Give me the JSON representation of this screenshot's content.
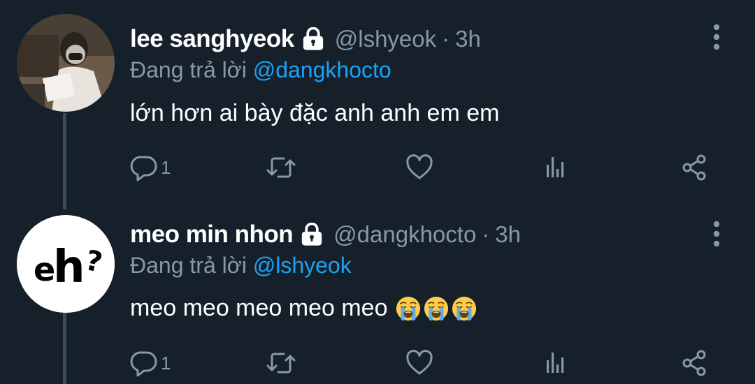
{
  "colors": {
    "background": "#15202b",
    "text_primary": "#ffffff",
    "text_secondary": "#8899a6",
    "accent": "#1da1f2",
    "thread_line": "#3d4b59"
  },
  "tweets": [
    {
      "display_name": "lee sanghyeok",
      "handle": "@lshyeok",
      "separator": "·",
      "time": "3h",
      "replying_prefix": "Đang trả lời",
      "replying_to": "@dangkhocto",
      "text": "lớn hơn ai bày đặc anh anh em em",
      "emojis": [],
      "reply_count": "1",
      "icons": [
        "lock-icon",
        "more-icon",
        "reply-icon",
        "retweet-icon",
        "like-icon",
        "analytics-icon",
        "share-icon"
      ]
    },
    {
      "display_name": "meo min nhon",
      "handle": "@dangkhocto",
      "separator": "·",
      "time": "3h",
      "replying_prefix": "Đang trả lời",
      "replying_to": "@lshyeok",
      "text": "meo meo meo meo meo",
      "emojis": [
        "loudly-crying-face",
        "loudly-crying-face",
        "loudly-crying-face"
      ],
      "avatar_text": "eh?",
      "reply_count": "1",
      "icons": [
        "lock-icon",
        "more-icon",
        "reply-icon",
        "retweet-icon",
        "like-icon",
        "analytics-icon",
        "share-icon"
      ]
    }
  ]
}
